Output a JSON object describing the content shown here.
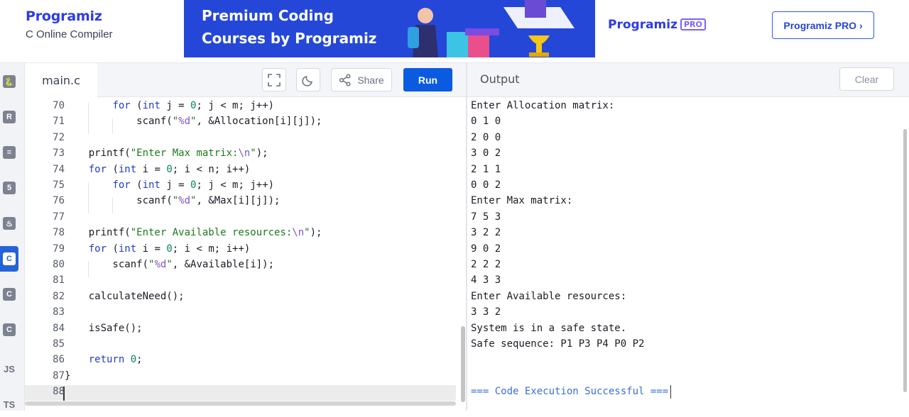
{
  "header": {
    "brand_name": "Programiz",
    "brand_subtitle": "C Online Compiler",
    "banner_line1": "Premium Coding",
    "banner_line2": "Courses by Programiz",
    "banner_logo": "Programiz",
    "banner_pro_badge": "PRO",
    "pro_button_label": "Programiz PRO ›",
    "colors": {
      "brand": "#2e3ae8",
      "banner": "#2547d8",
      "accent": "#0a5be0"
    }
  },
  "rail": {
    "items": [
      {
        "icon": "python-icon",
        "glyph": "🐍"
      },
      {
        "icon": "r-icon",
        "glyph": "R"
      },
      {
        "icon": "database-icon",
        "glyph": "≡"
      },
      {
        "icon": "html5-icon",
        "glyph": "5"
      },
      {
        "icon": "java-icon",
        "glyph": "♨"
      },
      {
        "icon": "c-icon",
        "glyph": "C"
      },
      {
        "icon": "cpp-icon",
        "glyph": "C"
      },
      {
        "icon": "csharp-icon",
        "glyph": "C"
      },
      {
        "icon": "js-icon",
        "glyph": "JS"
      },
      {
        "icon": "ts-icon",
        "glyph": "TS"
      }
    ]
  },
  "editor": {
    "tab_label": "main.c",
    "fullscreen_icon": "fullscreen-icon",
    "theme_icon": "moon-icon",
    "share_label": "Share",
    "run_label": "Run",
    "lines": [
      {
        "n": "70",
        "code": [
          {
            "t": "        "
          },
          {
            "k": "kw",
            "t": "for"
          },
          {
            "t": " ("
          },
          {
            "k": "kw",
            "t": "int"
          },
          {
            "t": " j = "
          },
          {
            "k": "num",
            "t": "0"
          },
          {
            "t": "; j < m; j++)"
          }
        ]
      },
      {
        "n": "71",
        "code": [
          {
            "t": "            scanf("
          },
          {
            "k": "str",
            "t": "\""
          },
          {
            "k": "fmt",
            "t": "%d"
          },
          {
            "k": "str",
            "t": "\""
          },
          {
            "t": ", &Allocation[i][j]);"
          }
        ]
      },
      {
        "n": "72",
        "code": [
          {
            "t": ""
          }
        ]
      },
      {
        "n": "73",
        "code": [
          {
            "t": "    printf("
          },
          {
            "k": "str",
            "t": "\"Enter Max matrix:"
          },
          {
            "k": "fmt",
            "t": "\\n"
          },
          {
            "k": "str",
            "t": "\""
          },
          {
            "t": ");"
          }
        ]
      },
      {
        "n": "74",
        "code": [
          {
            "t": "    "
          },
          {
            "k": "kw",
            "t": "for"
          },
          {
            "t": " ("
          },
          {
            "k": "kw",
            "t": "int"
          },
          {
            "t": " i = "
          },
          {
            "k": "num",
            "t": "0"
          },
          {
            "t": "; i < n; i++)"
          }
        ]
      },
      {
        "n": "75",
        "code": [
          {
            "t": "        "
          },
          {
            "k": "kw",
            "t": "for"
          },
          {
            "t": " ("
          },
          {
            "k": "kw",
            "t": "int"
          },
          {
            "t": " j = "
          },
          {
            "k": "num",
            "t": "0"
          },
          {
            "t": "; j < m; j++)"
          }
        ]
      },
      {
        "n": "76",
        "code": [
          {
            "t": "            scanf("
          },
          {
            "k": "str",
            "t": "\""
          },
          {
            "k": "fmt",
            "t": "%d"
          },
          {
            "k": "str",
            "t": "\""
          },
          {
            "t": ", &Max[i][j]);"
          }
        ]
      },
      {
        "n": "77",
        "code": [
          {
            "t": ""
          }
        ]
      },
      {
        "n": "78",
        "code": [
          {
            "t": "    printf("
          },
          {
            "k": "str",
            "t": "\"Enter Available resources:"
          },
          {
            "k": "fmt",
            "t": "\\n"
          },
          {
            "k": "str",
            "t": "\""
          },
          {
            "t": ");"
          }
        ]
      },
      {
        "n": "79",
        "code": [
          {
            "t": "    "
          },
          {
            "k": "kw",
            "t": "for"
          },
          {
            "t": " ("
          },
          {
            "k": "kw",
            "t": "int"
          },
          {
            "t": " i = "
          },
          {
            "k": "num",
            "t": "0"
          },
          {
            "t": "; i < m; i++)"
          }
        ]
      },
      {
        "n": "80",
        "code": [
          {
            "t": "        scanf("
          },
          {
            "k": "str",
            "t": "\""
          },
          {
            "k": "fmt",
            "t": "%d"
          },
          {
            "k": "str",
            "t": "\""
          },
          {
            "t": ", &Available[i]);"
          }
        ]
      },
      {
        "n": "81",
        "code": [
          {
            "t": ""
          }
        ]
      },
      {
        "n": "82",
        "code": [
          {
            "t": "    calculateNeed();"
          }
        ]
      },
      {
        "n": "83",
        "code": [
          {
            "t": ""
          }
        ]
      },
      {
        "n": "84",
        "code": [
          {
            "t": "    isSafe();"
          }
        ]
      },
      {
        "n": "85",
        "code": [
          {
            "t": ""
          }
        ]
      },
      {
        "n": "86",
        "code": [
          {
            "t": "    "
          },
          {
            "k": "kw",
            "t": "return"
          },
          {
            "t": " "
          },
          {
            "k": "num",
            "t": "0"
          },
          {
            "t": ";"
          }
        ]
      },
      {
        "n": "87",
        "code": [
          {
            "t": "}"
          }
        ]
      },
      {
        "n": "88",
        "code": [
          {
            "t": ""
          }
        ]
      }
    ]
  },
  "output": {
    "title": "Output",
    "clear_label": "Clear",
    "lines": [
      "Enter Allocation matrix:",
      "0 1 0",
      "2 0 0",
      "3 0 2",
      "2 1 1",
      "0 0 2",
      "Enter Max matrix:",
      "7 5 3",
      "3 2 2",
      "9 0 2",
      "2 2 2",
      "4 3 3",
      "Enter Available resources:",
      "3 3 2",
      "System is in a safe state.",
      "Safe sequence: P1 P3 P4 P0 P2",
      "",
      "",
      "=== Code Execution Successful ==="
    ]
  }
}
